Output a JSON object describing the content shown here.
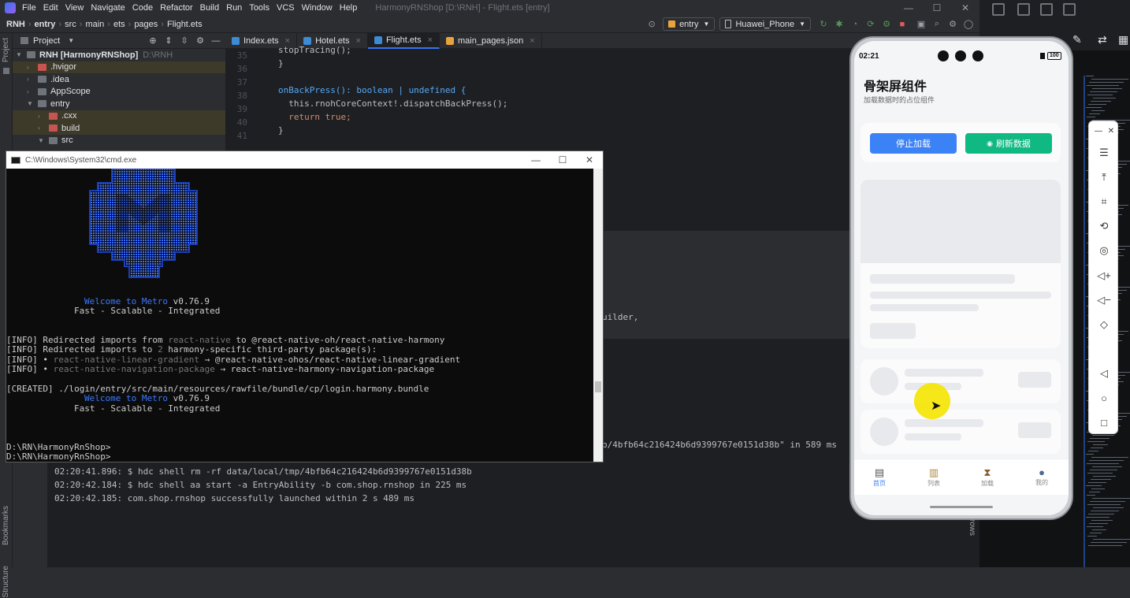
{
  "ide": {
    "menu": [
      "File",
      "Edit",
      "View",
      "Navigate",
      "Code",
      "Refactor",
      "Build",
      "Run",
      "Tools",
      "VCS",
      "Window",
      "Help"
    ],
    "window_title": "HarmonyRNShop [D:\\RNH] - Flight.ets [entry]",
    "breadcrumb": [
      "RNH",
      "entry",
      "src",
      "main",
      "ets",
      "pages",
      "Flight.ets"
    ],
    "run_config": "entry",
    "device": "Huawei_Phone",
    "project_label": "Project",
    "tree": [
      {
        "label": "RNH [HarmonyRNShop]",
        "path": "D:\\RNH"
      },
      {
        "label": ".hvigor"
      },
      {
        "label": ".idea"
      },
      {
        "label": "AppScope"
      },
      {
        "label": "entry"
      },
      {
        "label": ".cxx"
      },
      {
        "label": "build"
      },
      {
        "label": "src"
      }
    ],
    "tabs": [
      "Index.ets",
      "Hotel.ets",
      "Flight.ets",
      "main_pages.json"
    ],
    "gutter": [
      "35",
      "36",
      "37",
      "38",
      "39",
      "40",
      "41"
    ],
    "code": [
      "stopTracing();",
      "}",
      "",
      "onBackPress(): boolean | undefined {",
      "  this.rnohCoreContext!.dispatchBackPress();",
      "  return true;",
      "}"
    ],
    "side_tabs": {
      "bookmarks": "Bookmarks",
      "structure": "Structure",
      "device_file": "Device File Brows"
    },
    "run_fragments": {
      "builder": "uilder,",
      "install": "p/4bfb64c216424b6d9399767e0151d38b\" in 589 ms"
    },
    "run_log": [
      "02:20:41.896: $ hdc shell rm -rf data/local/tmp/4bfb64c216424b6d9399767e0151d38b",
      "02:20:42.184: $ hdc shell aa start -a EntryAbility -b com.shop.rnshop in 225 ms",
      "02:20:42.185: com.shop.rnshop successfully launched within 2 s 489 ms"
    ]
  },
  "cmd": {
    "title": "C:\\Windows\\System32\\cmd.exe",
    "welcome_1": "Welcome to Metro",
    "version_1": "v0.76.9",
    "tagline_1": "Fast - Scalable - Integrated",
    "info_lines": [
      {
        "prefix": "[INFO] Redirected imports from ",
        "dim": "react-native",
        "suffix": " to @react-native-oh/react-native-harmony"
      },
      {
        "prefix": "[INFO] Redirected imports to ",
        "dim": "2",
        "suffix": " harmony-specific third-party package(s):"
      },
      {
        "prefix": "[INFO] • ",
        "dim": "react-native-linear-gradient",
        "suffix": " → @react-native-ohos/react-native-linear-gradient"
      },
      {
        "prefix": "[INFO] • ",
        "dim": "react-native-navigation-package",
        "suffix": " → react-native-harmony-navigation-package"
      }
    ],
    "created": "[CREATED] ./login/entry/src/main/resources/rawfile/bundle/cp/login.harmony.bundle",
    "welcome_2": "Welcome to Metro",
    "version_2": "v0.76.9",
    "tagline_2": "Fast - Scalable - Integrated",
    "prompt_1": "D:\\RN\\HarmonyRnShop>",
    "prompt_2": "D:\\RN\\HarmonyRnShop>"
  },
  "phone": {
    "time": "02:21",
    "battery": "100",
    "title": "骨架屏组件",
    "subtitle": "加载数据时的占位组件",
    "stop_button": "停止加载",
    "refresh_button": "刷新数据",
    "nav": [
      "首页",
      "列表",
      "加载",
      "我的"
    ],
    "colors": {
      "primary": "#3b82f6",
      "secondary": "#10b981",
      "active_nav": "#3b82f6"
    }
  },
  "colors": {
    "accent": "#3574f0",
    "cmd_blue": "#3b78ff",
    "cursor_highlight": "#f5e400"
  }
}
